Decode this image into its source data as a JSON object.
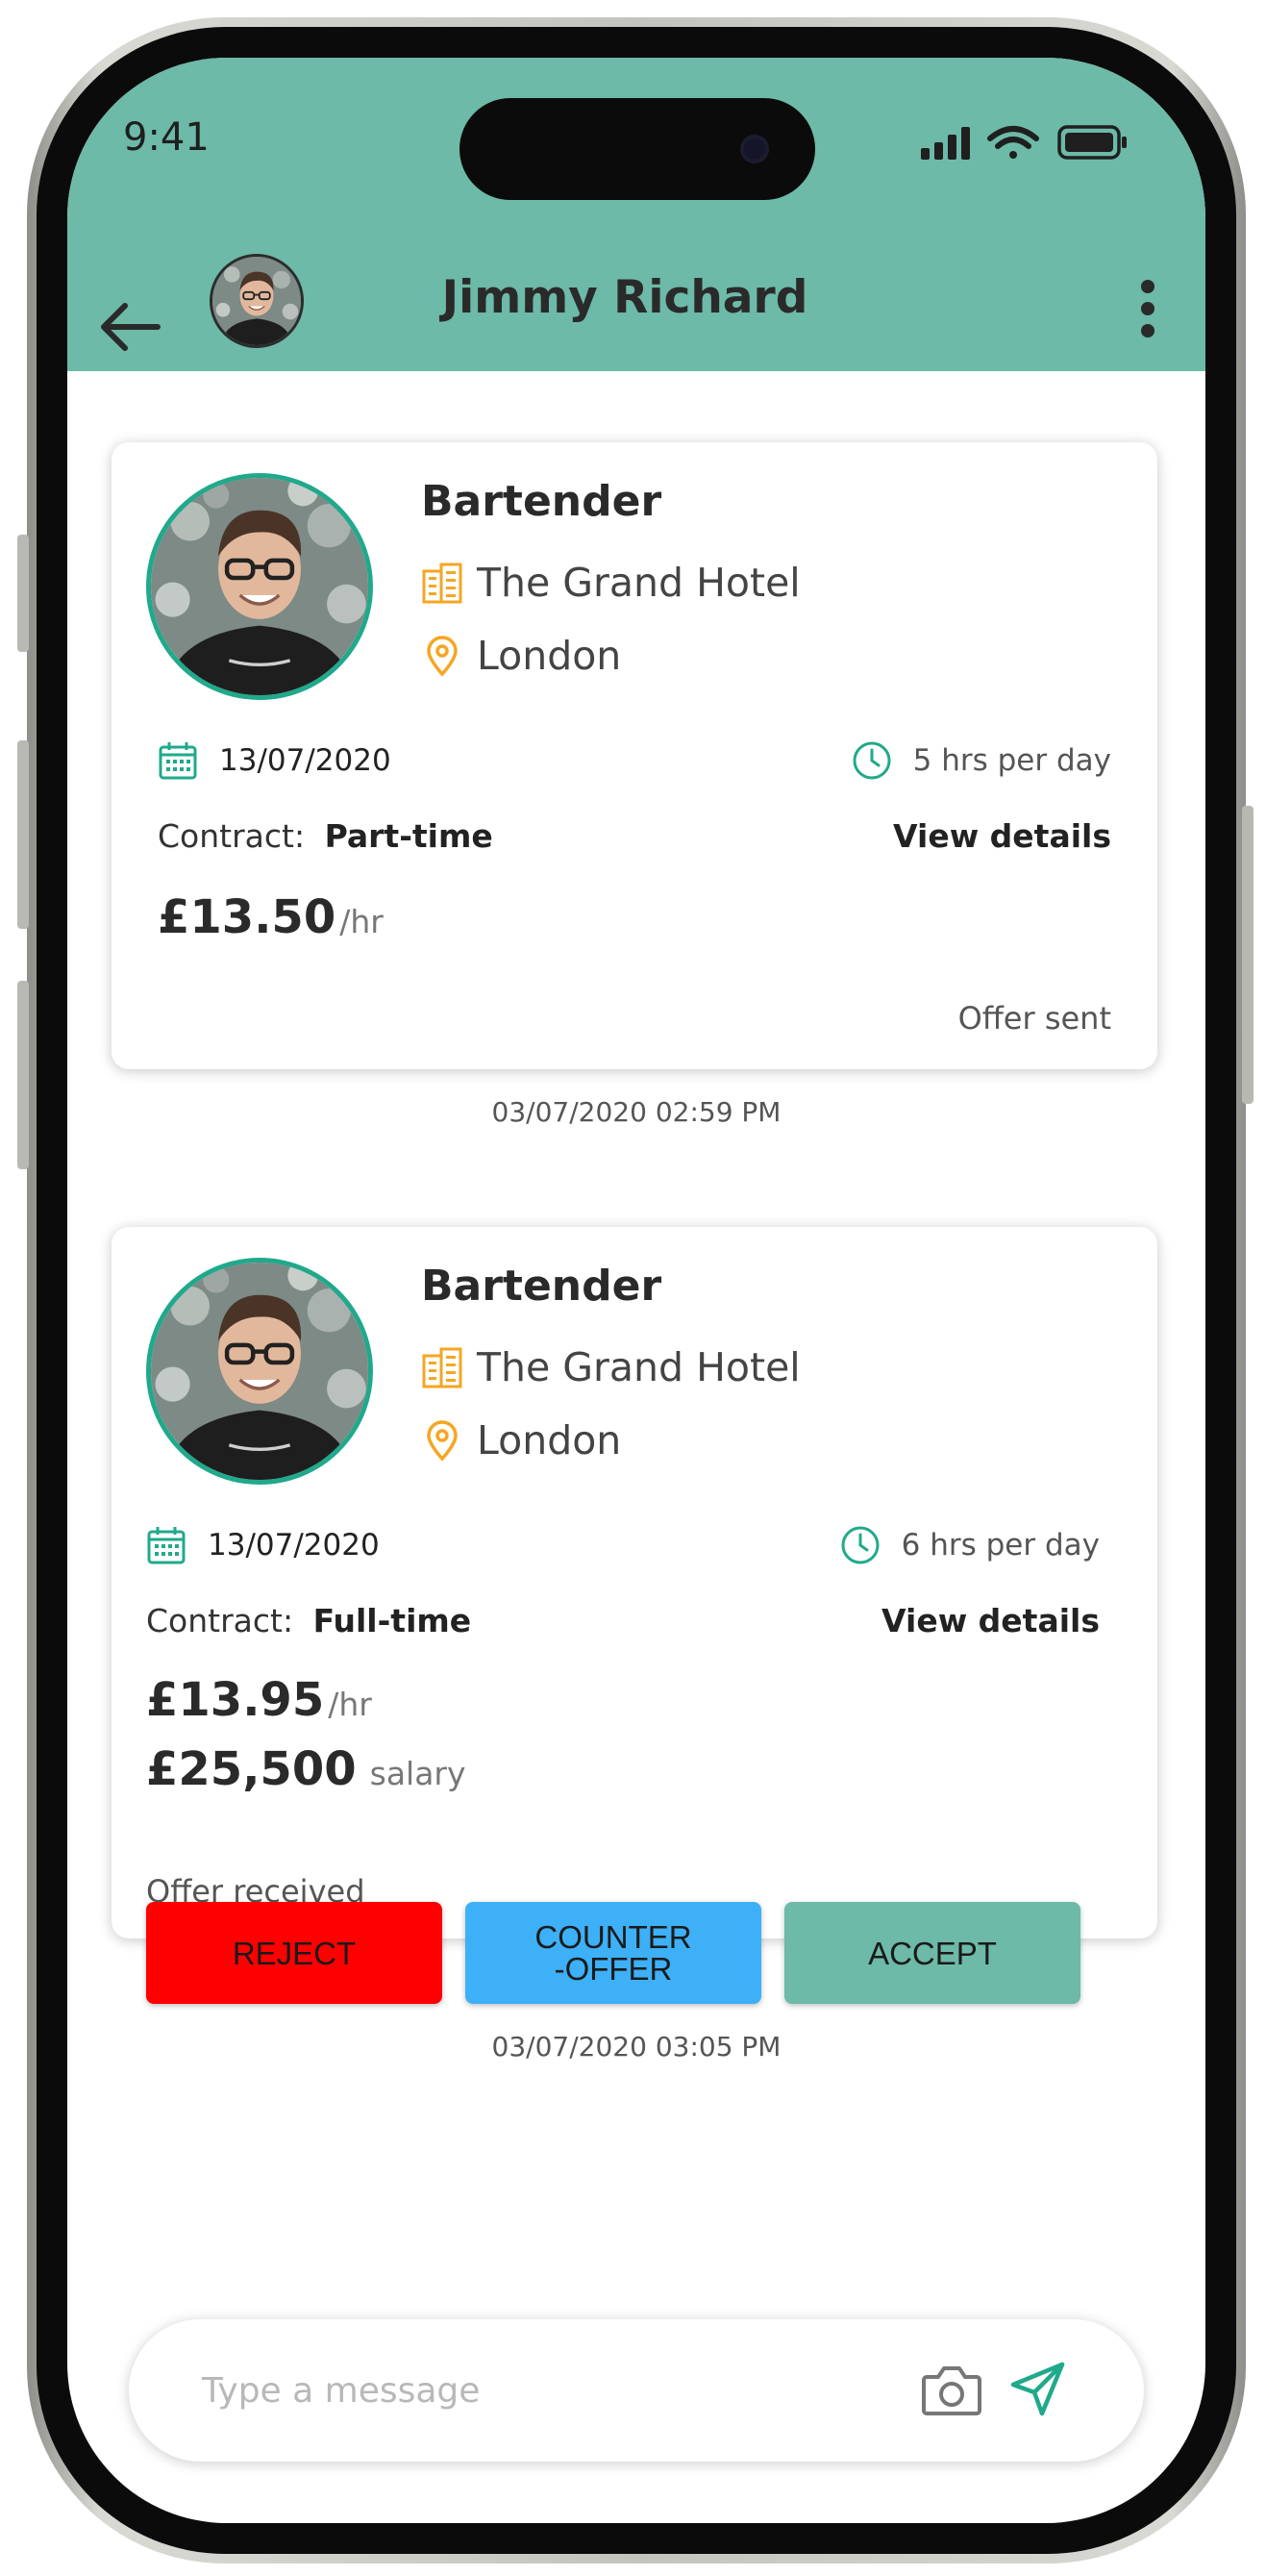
{
  "status_bar": {
    "time": "9:41"
  },
  "header": {
    "contact_name": "Jimmy Richard"
  },
  "offers": [
    {
      "job_title": "Bartender",
      "company": "The Grand Hotel",
      "location": "London",
      "date": "13/07/2020",
      "hours": "5 hrs per day",
      "contract_label": "Contract:",
      "contract_type": "Part-time",
      "view_details": "View details",
      "hourly_rate": "£13.50",
      "hourly_unit": "/hr",
      "status": "Offer sent",
      "timestamp": "03/07/2020 02:59  PM"
    },
    {
      "job_title": "Bartender",
      "company": "The Grand Hotel",
      "location": "London",
      "date": "13/07/2020",
      "hours": "6 hrs per day",
      "contract_label": "Contract:",
      "contract_type": "Full-time",
      "view_details": "View details",
      "hourly_rate": "£13.95",
      "hourly_unit": "/hr",
      "salary": "£25,500",
      "salary_unit": "salary",
      "status": "Offer received",
      "timestamp": "03/07/2020 03:05  PM"
    }
  ],
  "actions": {
    "reject": "REJECT",
    "counter_line1": "COUNTER",
    "counter_line2": "-OFFER",
    "accept": "ACCEPT"
  },
  "composer": {
    "placeholder": "Type a message"
  },
  "icons": {
    "back": "arrow-left-icon",
    "more": "more-vertical-icon",
    "company": "building-icon",
    "location": "map-pin-icon",
    "date": "calendar-icon",
    "hours": "clock-icon",
    "camera": "camera-icon",
    "send": "send-icon"
  },
  "colors": {
    "header_bg": "#6cbaa7",
    "accent_teal": "#20a98b",
    "accent_orange": "#f5a623",
    "reject": "#ff0000",
    "counter_offer": "#3db0f7",
    "accept": "#6cbaa7"
  }
}
